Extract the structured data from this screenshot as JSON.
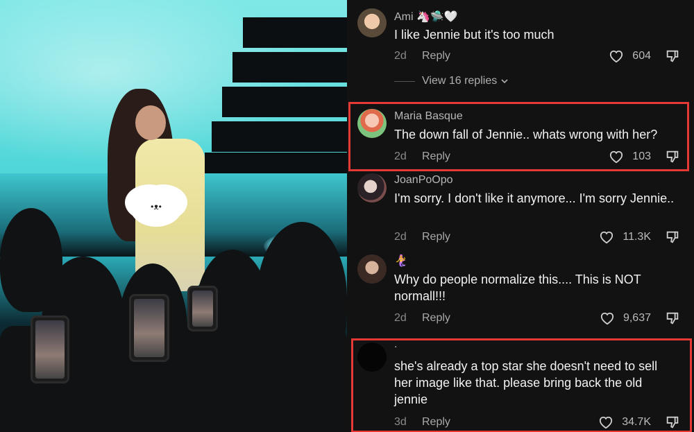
{
  "comments": [
    {
      "username": "Ami 🦄🛸🤍",
      "text": "I like Jennie but it's too much",
      "time": "2d",
      "reply": "Reply",
      "likes": "604",
      "avatar": "girl-avatar"
    },
    {
      "username": "Maria Basque",
      "text": "The down fall of Jennie.. whats wrong with her?",
      "time": "2d",
      "reply": "Reply",
      "likes": "103",
      "avatar": "cartoon-avatar"
    },
    {
      "username": "JoanPoOpo",
      "text": "I'm sorry. I don't like it anymore... I'm sorry Jennie..",
      "time": "2d",
      "reply": "Reply",
      "likes": "11.3K",
      "avatar": "photo-avatar"
    },
    {
      "username": "🧜‍♀️",
      "text": "Why do people normalize this.... This is NOT normall!!!",
      "time": "2d",
      "reply": "Reply",
      "likes": "9,637",
      "avatar": "selfie-avatar"
    },
    {
      "username": ".",
      "text": "she's already a top star she doesn't need to sell her image like that. please bring back the old jennie",
      "time": "3d",
      "reply": "Reply",
      "likes": "34.7K",
      "avatar": "black-avatar"
    }
  ],
  "view_replies": "View 16 replies",
  "colors": {
    "highlight": "#e53935",
    "background": "#121212"
  },
  "icons": [
    "heart-icon",
    "dislike-icon",
    "chevron-down-icon"
  ]
}
